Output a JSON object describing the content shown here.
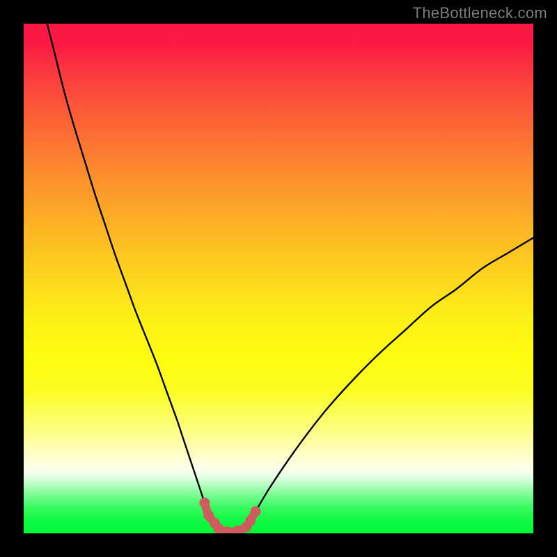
{
  "watermark": {
    "text": "TheBottleneck.com"
  },
  "colors": {
    "background": "#000000",
    "curve_stroke": "#000000",
    "highlight_stroke": "#cd5d5e",
    "highlight_fill": "#cd5d5e",
    "gradient_top": "#fb1745",
    "gradient_bottom": "#00f93a"
  },
  "chart_data": {
    "type": "line",
    "title": "",
    "xlabel": "",
    "ylabel": "",
    "xlim": [
      0,
      100
    ],
    "ylim": [
      0,
      100
    ],
    "grid": false,
    "legend": false,
    "series": [
      {
        "name": "bottleneck-curve",
        "x": [
          4.6,
          6,
          8,
          10,
          12,
          14,
          16,
          18,
          20,
          22,
          24,
          26,
          28,
          30,
          31,
          32,
          33,
          34,
          35,
          36,
          37,
          38,
          39,
          40,
          41,
          42,
          43,
          45,
          48,
          52,
          56,
          60,
          65,
          70,
          75,
          80,
          85,
          90,
          95,
          100
        ],
        "y": [
          100,
          94.5,
          86.5,
          79.5,
          73,
          66.5,
          60.5,
          54.5,
          49,
          43.5,
          38.5,
          33.5,
          28,
          22.5,
          19.5,
          16.5,
          13.5,
          10.5,
          7.5,
          4.5,
          2.5,
          1.1,
          0.6,
          0.3,
          0.3,
          0.5,
          1,
          3.5,
          8.5,
          14.5,
          20,
          25,
          30.5,
          35.5,
          40,
          44.5,
          48,
          52,
          55,
          58
        ]
      }
    ],
    "highlight": {
      "name": "sweet-spot",
      "x": [
        35.5,
        36.3,
        37.5,
        38.2,
        40.0,
        42.0,
        43.7,
        44.5,
        45.5
      ],
      "y": [
        6.0,
        3.5,
        2.0,
        1.0,
        0.3,
        0.5,
        1.3,
        2.5,
        4.3
      ]
    }
  }
}
